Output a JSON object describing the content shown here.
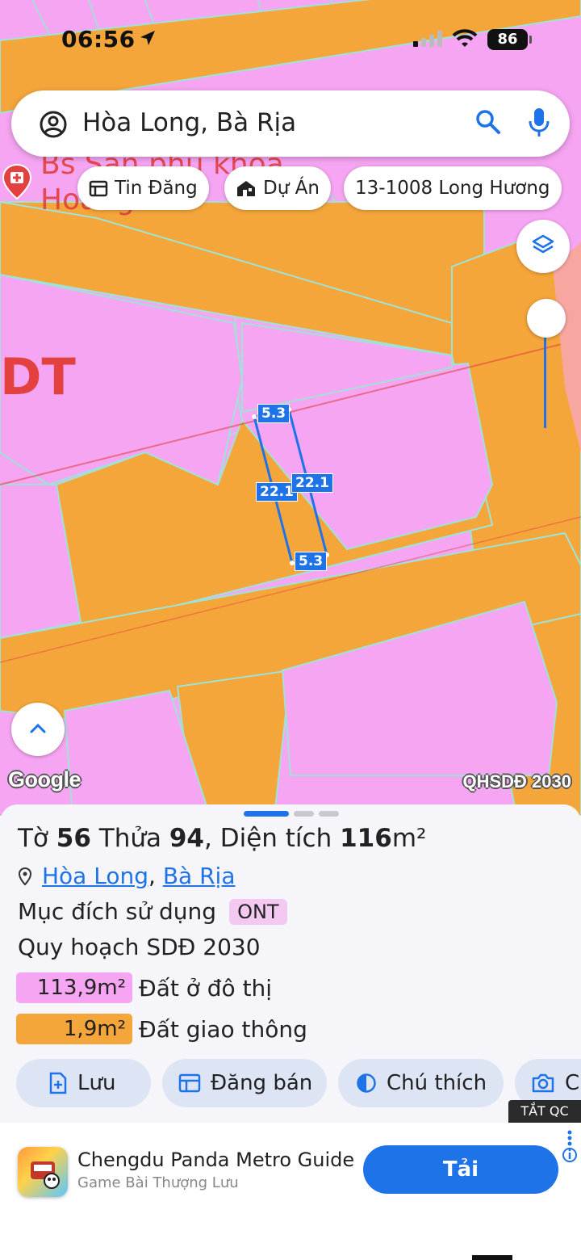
{
  "status_bar": {
    "time": "06:56",
    "battery": "86"
  },
  "search": {
    "query": "Hòa Long, Bà Rịa"
  },
  "chips": [
    {
      "label": "Tin Đăng",
      "icon": "calendar-icon"
    },
    {
      "label": "Dự Án",
      "icon": "house-icon"
    },
    {
      "label": "13-1008 Long Hương"
    }
  ],
  "map": {
    "poi_label": "Bs Sản phụ khoa\nHoàng Lan",
    "zone_label": "DT",
    "measurements": [
      "5.3",
      "22.1",
      "22.1",
      "5.3"
    ],
    "attribution": "Google",
    "layer_label": "QHSDĐ 2030"
  },
  "parcel": {
    "to_label": "Tờ",
    "to_value": "56",
    "thua_label": "Thửa",
    "thua_value": "94",
    "area_label": "Diện tích",
    "area_value": "116",
    "area_unit": "m²",
    "location_parts": [
      "Hòa Long",
      "Bà Rịa"
    ],
    "purpose_label": "Mục đích sử dụng",
    "purpose_code": "ONT",
    "plan_label": "Quy hoạch SDĐ 2030",
    "allocations": [
      {
        "amount": "113,9m²",
        "label": "Đất ở đô thị",
        "color": "#f6a5f2"
      },
      {
        "amount": "1,9m²",
        "label": "Đất giao thông",
        "color": "#f5a63a"
      }
    ]
  },
  "actions": [
    {
      "label": "Lưu",
      "icon": "add-file-icon"
    },
    {
      "label": "Đăng bán",
      "icon": "calendar-icon"
    },
    {
      "label": "Chú thích",
      "icon": "contrast-icon"
    },
    {
      "label": "C",
      "icon": "camera-icon"
    }
  ],
  "ad": {
    "close_label": "TẮT QC",
    "title": "Chengdu Panda Metro Guide",
    "subtitle": "Game Bài Thượng Lưu",
    "cta": "Tải"
  },
  "colors": {
    "accent": "#1e73e8",
    "land": "#f6a5f2",
    "road": "#f5a63a"
  }
}
